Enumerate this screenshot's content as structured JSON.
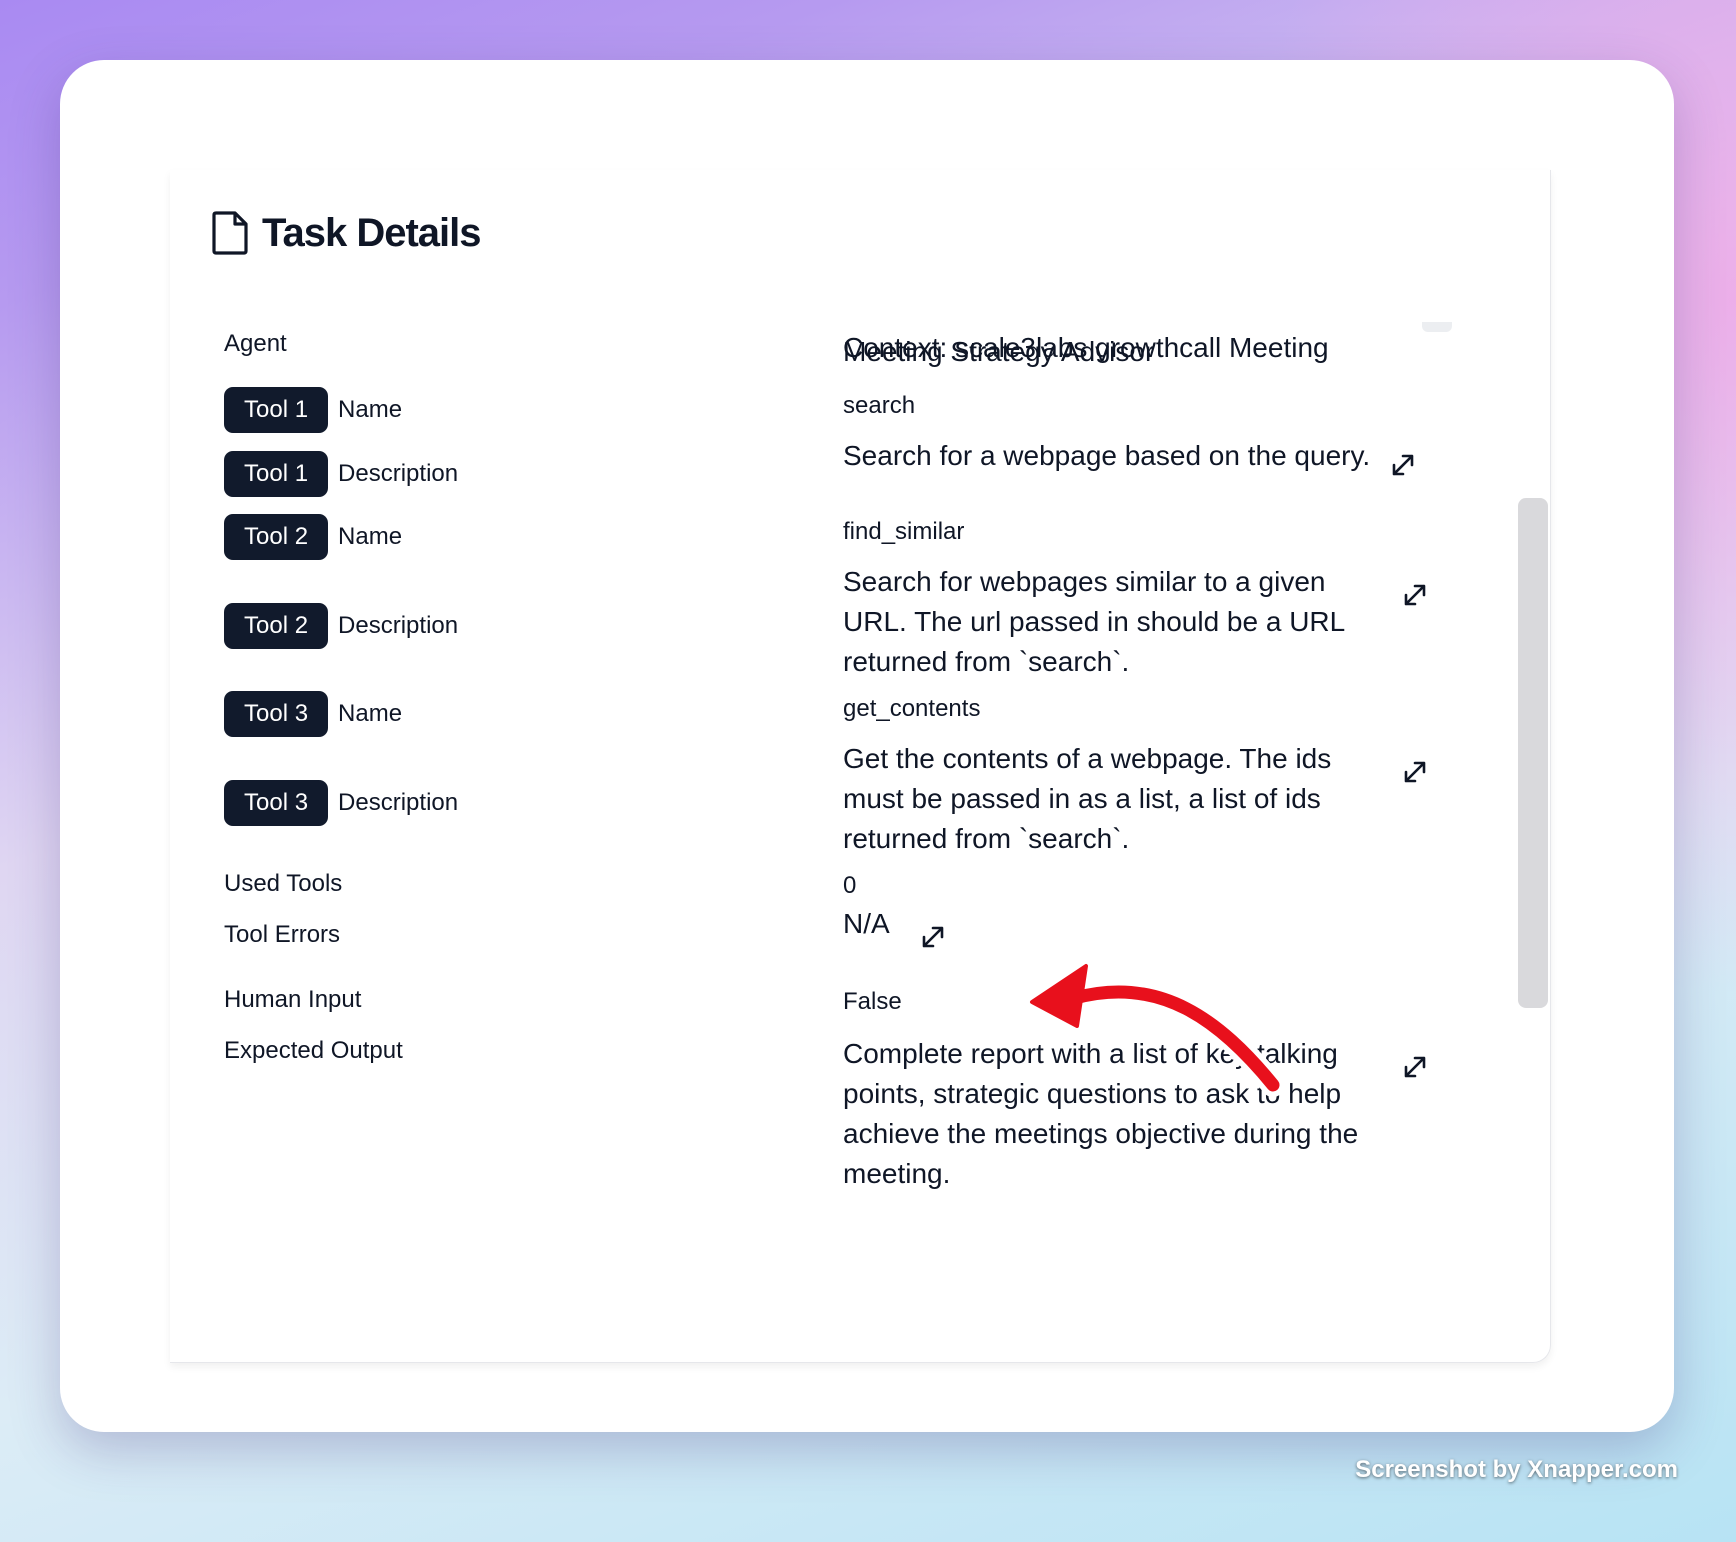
{
  "page": {
    "title": "Task Details",
    "context_line": "Context: scale3labs growthcall Meeting"
  },
  "rows": [
    {
      "label": "Agent",
      "value": "Meeting Strategy Advisor"
    },
    {
      "badge": "Tool 1",
      "label": "Name",
      "value": "search"
    },
    {
      "badge": "Tool 1",
      "label": "Description",
      "value": "Search for a webpage based on the query."
    },
    {
      "badge": "Tool 2",
      "label": "Name",
      "value": "find_similar"
    },
    {
      "badge": "Tool 2",
      "label": "Description",
      "value": "Search for webpages similar to a given URL. The url passed in should be a URL returned from `search`."
    },
    {
      "badge": "Tool 3",
      "label": "Name",
      "value": "get_contents"
    },
    {
      "badge": "Tool 3",
      "label": "Description",
      "value": "Get the contents of a webpage. The ids must be passed in as a list, a list of ids returned from `search`."
    },
    {
      "label": "Used Tools",
      "value": "0"
    },
    {
      "label": "Tool Errors",
      "value": "N/A"
    },
    {
      "label": "Human Input",
      "value": "False"
    },
    {
      "label": "Expected Output",
      "value": "Complete report with a list of key talking points, strategic questions to ask to help achieve the meetings objective during the meeting."
    }
  ],
  "icons": {
    "title_icon": "document-icon",
    "expand_icon": "expand-icon",
    "annotation": "red-arrow-icon"
  },
  "colors": {
    "badge_bg": "#111a2c",
    "annotation_arrow": "#e8101c",
    "scrollbar": "#d9d9dc"
  },
  "watermark": "Screenshot by Xnapper.com"
}
